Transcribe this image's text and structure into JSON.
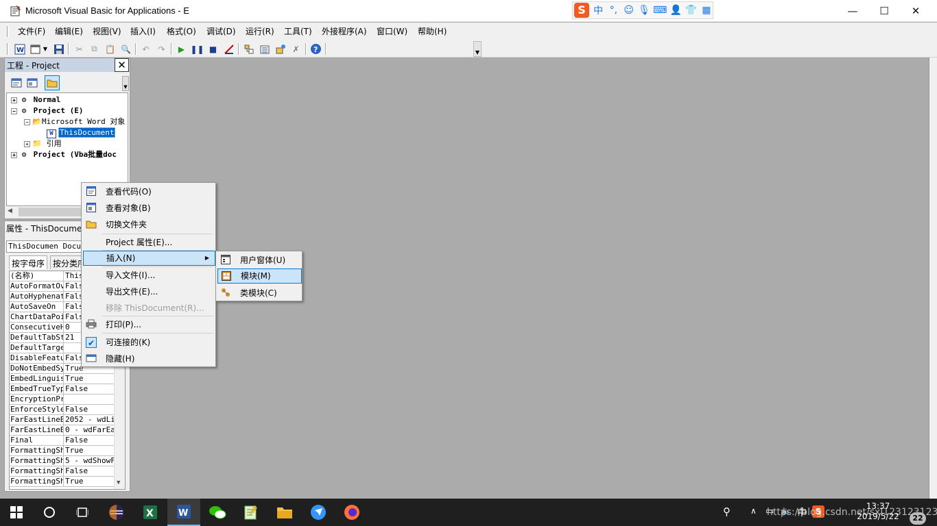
{
  "window": {
    "title": "Microsoft Visual Basic for Applications - E",
    "minimize": "—",
    "maximize": "☐",
    "close": "✕"
  },
  "ime": {
    "logo": "S",
    "mode": "中",
    "punct": "°,"
  },
  "menubar": {
    "items": [
      "文件(F)",
      "编辑(E)",
      "视图(V)",
      "插入(I)",
      "格式(O)",
      "调试(D)",
      "运行(R)",
      "工具(T)",
      "外接程序(A)",
      "窗口(W)",
      "帮助(H)"
    ]
  },
  "project": {
    "title": "工程 - Project",
    "close": "✕",
    "tree": [
      {
        "label": "Normal",
        "expander": "+",
        "bold": true
      },
      {
        "label": "Project (E)",
        "expander": "−",
        "bold": true
      },
      {
        "label": "Microsoft Word 对象",
        "expander": "−"
      },
      {
        "label": "ThisDocument",
        "selected": true
      },
      {
        "label": "引用",
        "expander": "+"
      },
      {
        "label": "Project (Vba批量doc",
        "expander": "+",
        "bold": true
      }
    ]
  },
  "properties": {
    "title": "属性 - ThisDocument",
    "object": "ThisDocumen  Docu",
    "tabs": [
      "按字母序",
      "按分类序"
    ],
    "rows": [
      [
        "(名称)",
        "This"
      ],
      [
        "AutoFormatOve",
        "False"
      ],
      [
        "AutoHyphenati",
        "False"
      ],
      [
        "AutoSaveOn",
        "False"
      ],
      [
        "ChartDataPoir",
        "False"
      ],
      [
        "ConsecutiveHy",
        "0"
      ],
      [
        "DefaultTabSto",
        "21"
      ],
      [
        "DefaultTarget",
        ""
      ],
      [
        "DisableFeatur",
        "False"
      ],
      [
        "DoNotEmbedSys",
        "True"
      ],
      [
        "EmbedLinguist",
        "True"
      ],
      [
        "EmbedTrueType",
        "False"
      ],
      [
        "EncryptionPro",
        ""
      ],
      [
        "EnforceStyle",
        "False"
      ],
      [
        "FarEastLineBr",
        "2052 - wdLi"
      ],
      [
        "FarEastLineBr",
        "0 - wdFarEa"
      ],
      [
        "Final",
        "False"
      ],
      [
        "FormattingSho",
        "True"
      ],
      [
        "FormattingSho",
        "5 - wdShowFi"
      ],
      [
        "FormattingSho",
        "False"
      ],
      [
        "FormattingSho",
        "True"
      ]
    ]
  },
  "context_menu": {
    "items": [
      {
        "label": "查看代码(O)",
        "icon": "code-window-icon"
      },
      {
        "label": "查看对象(B)",
        "icon": "object-window-icon"
      },
      {
        "label": "切换文件夹",
        "icon": "folder-icon"
      },
      {
        "label": "Project 属性(E)..."
      },
      {
        "label": "插入(N)",
        "submenu": true,
        "highlighted": true
      },
      {
        "label": "导入文件(I)..."
      },
      {
        "label": "导出文件(E)..."
      },
      {
        "label": "移除 ThisDocument(R)...",
        "disabled": true
      },
      {
        "label": "打印(P)...",
        "icon": "printer-icon"
      },
      {
        "label": "可连接的(K)",
        "icon": "check-icon"
      },
      {
        "label": "隐藏(H)",
        "icon": "hide-window-icon"
      }
    ]
  },
  "submenu": {
    "items": [
      {
        "label": "用户窗体(U)",
        "icon": "userform-icon"
      },
      {
        "label": "模块(M)",
        "icon": "module-icon",
        "highlighted": true
      },
      {
        "label": "类模块(C)",
        "icon": "class-module-icon"
      }
    ]
  },
  "taskbar": {
    "clock_time": "13:37",
    "clock_date": "2019/5/22",
    "ime_indicator": "中",
    "notifications": "22",
    "watermark": "https://blog.csdn.net/sxl123123123"
  },
  "colors": {
    "highlight": "#cce4f7",
    "highlight_border": "#0078d7",
    "selection": "#0066cc",
    "workspace": "#ababab"
  }
}
